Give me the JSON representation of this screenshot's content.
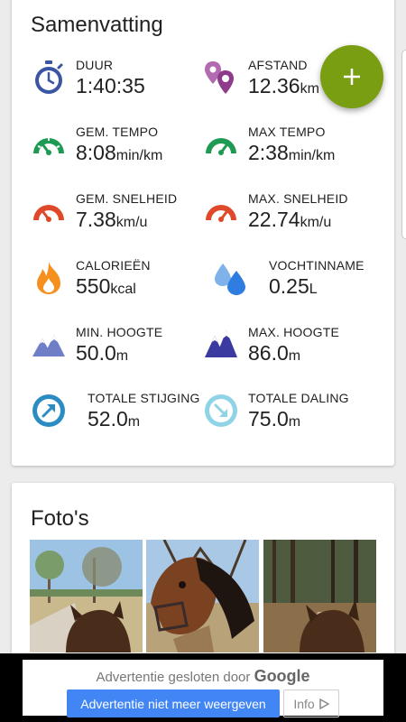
{
  "summary": {
    "title": "Samenvatting",
    "stats": {
      "duration": {
        "label": "DUUR",
        "value": "1:40:35",
        "unit": ""
      },
      "distance": {
        "label": "AFSTAND",
        "value": "12.36",
        "unit": "km"
      },
      "avg_pace": {
        "label": "GEM. TEMPO",
        "value": "8:08",
        "unit": "min/km"
      },
      "max_pace": {
        "label": "MAX TEMPO",
        "value": "2:38",
        "unit": "min/km"
      },
      "avg_speed": {
        "label": "GEM. SNELHEID",
        "value": "7.38",
        "unit": "km/u"
      },
      "max_speed": {
        "label": "MAX. SNELHEID",
        "value": "22.74",
        "unit": "km/u"
      },
      "calories": {
        "label": "CALORIEËN",
        "value": "550",
        "unit": "kcal"
      },
      "hydration": {
        "label": "VOCHTINNAME",
        "value": "0.25",
        "unit": "L"
      },
      "min_altitude": {
        "label": "MIN. HOOGTE",
        "value": "50.0",
        "unit": "m"
      },
      "max_altitude": {
        "label": "MAX. HOOGTE",
        "value": "86.0",
        "unit": "m"
      },
      "total_ascent": {
        "label": "TOTALE STIJGING",
        "value": "52.0",
        "unit": "m"
      },
      "total_descent": {
        "label": "TOTALE DALING",
        "value": "75.0",
        "unit": "m"
      }
    }
  },
  "fab": {
    "icon": "plus-icon",
    "color": "#7a9e12"
  },
  "photos": {
    "title": "Foto's"
  },
  "ad": {
    "closed_text": "Advertentie gesloten door",
    "brand": "Google",
    "stop_button": "Advertentie niet meer weergeven",
    "info_button": "Info"
  },
  "colors": {
    "duration_icon": "#3a56a3",
    "distance_icon": "#8e3b8c",
    "pace_icon": "#1f9a52",
    "speed_icon": "#e0482a",
    "calories_icon": "#f5901e",
    "hydration_icon": "#2f7de1",
    "altitude_min_icon": "#6f7fc7",
    "altitude_max_icon": "#3a3aa0",
    "ascent_icon": "#2b8cc4",
    "descent_icon": "#8fd3e6",
    "ad_button": "#4285f4"
  }
}
